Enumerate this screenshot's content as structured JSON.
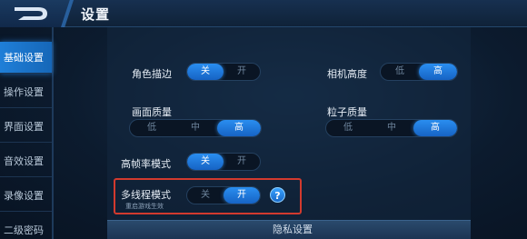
{
  "header": {
    "title": "设置"
  },
  "sidebar": {
    "items": [
      {
        "label": "基础设置",
        "active": true
      },
      {
        "label": "操作设置",
        "active": false
      },
      {
        "label": "界面设置",
        "active": false
      },
      {
        "label": "音效设置",
        "active": false
      },
      {
        "label": "录像设置",
        "active": false
      },
      {
        "label": "二级密码",
        "active": false
      }
    ]
  },
  "panel": {
    "top_ghost": "",
    "settings": {
      "outline": {
        "label": "角色描边",
        "options": [
          "关",
          "开"
        ],
        "selected": "关"
      },
      "camera_height": {
        "label": "相机高度",
        "options": [
          "低",
          "高"
        ],
        "selected": "高"
      },
      "quality": {
        "label": "画面质量",
        "options": [
          "低",
          "中",
          "高"
        ],
        "selected": "高"
      },
      "particles": {
        "label": "粒子质量",
        "options": [
          "低",
          "中",
          "高"
        ],
        "selected": "高"
      },
      "high_fps": {
        "label": "高帧率模式",
        "options": [
          "关",
          "开"
        ],
        "selected": "关"
      },
      "multithread": {
        "label": "多线程模式",
        "sublabel": "重启游戏生效",
        "options": [
          "关",
          "开"
        ],
        "selected": "开",
        "help": "?"
      }
    },
    "bottom_title": "隐私设置"
  },
  "colors": {
    "accent": "#1f7fd8",
    "highlight": "#d23a2e",
    "background": "#0b1a2c"
  }
}
